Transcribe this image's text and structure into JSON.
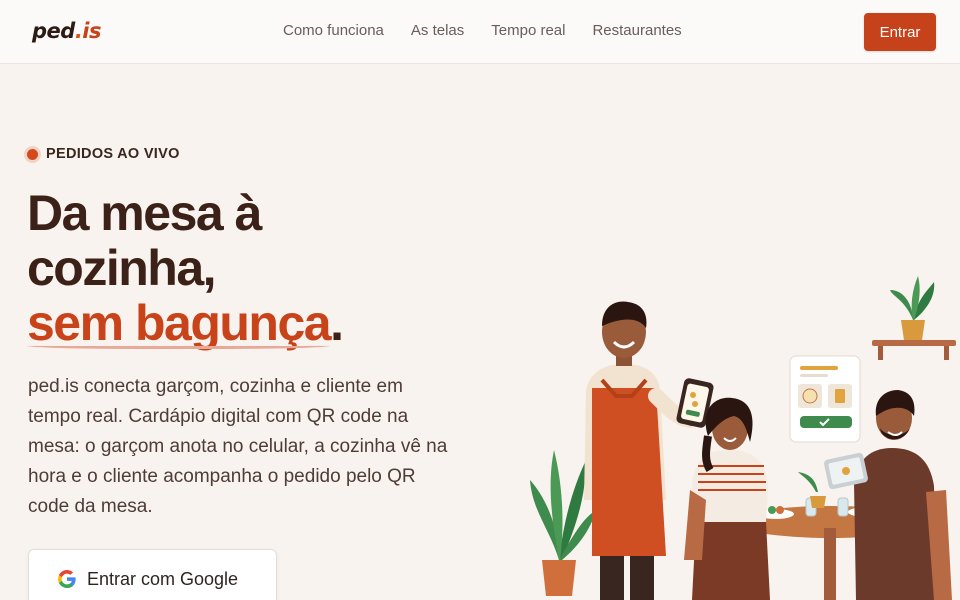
{
  "header": {
    "logo": {
      "part1": "ped",
      "dot": ".",
      "part2": "is"
    },
    "nav": [
      "Como funciona",
      "As telas",
      "Tempo real",
      "Restaurantes"
    ],
    "cta_label": "Entrar"
  },
  "hero": {
    "badge": "PEDIDOS AO VIVO",
    "headline_line1": "Da mesa à",
    "headline_line2": "cozinha,",
    "headline_accent": "sem bagunça",
    "headline_period": ".",
    "description": "ped.is conecta garçom, cozinha e cliente em tempo real. Cardápio digital com QR code na mesa: o garçom anota no celular, a cozinha vê na hora e o cliente acompanha o pedido pelo QR code da mesa.",
    "google_button": "Entrar com Google"
  },
  "colors": {
    "brand": "#c5421a",
    "background": "#f8f3ee",
    "text_dark": "#3b2118"
  },
  "icons": {
    "badge": "live-dot-icon",
    "google": "google-g-icon"
  }
}
